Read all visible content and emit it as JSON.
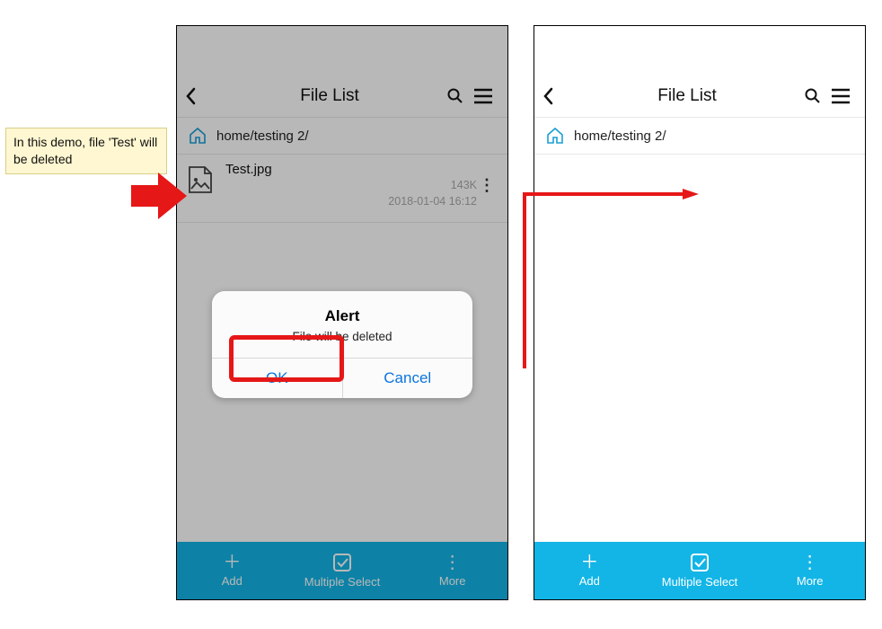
{
  "note": "In this demo, file 'Test' will be deleted",
  "left": {
    "header": {
      "title": "File List"
    },
    "path": "home/testing 2/",
    "file": {
      "name": "Test.jpg",
      "size": "143K",
      "datetime": "2018-01-04 16:12"
    },
    "dialog": {
      "title": "Alert",
      "message": "File will be deleted",
      "ok": "OK",
      "cancel": "Cancel"
    },
    "bottom": {
      "add": "Add",
      "multi": "Multiple Select",
      "more": "More"
    }
  },
  "right": {
    "header": {
      "title": "File List"
    },
    "path": "home/testing 2/",
    "bottom": {
      "add": "Add",
      "multi": "Multiple Select",
      "more": "More"
    }
  }
}
